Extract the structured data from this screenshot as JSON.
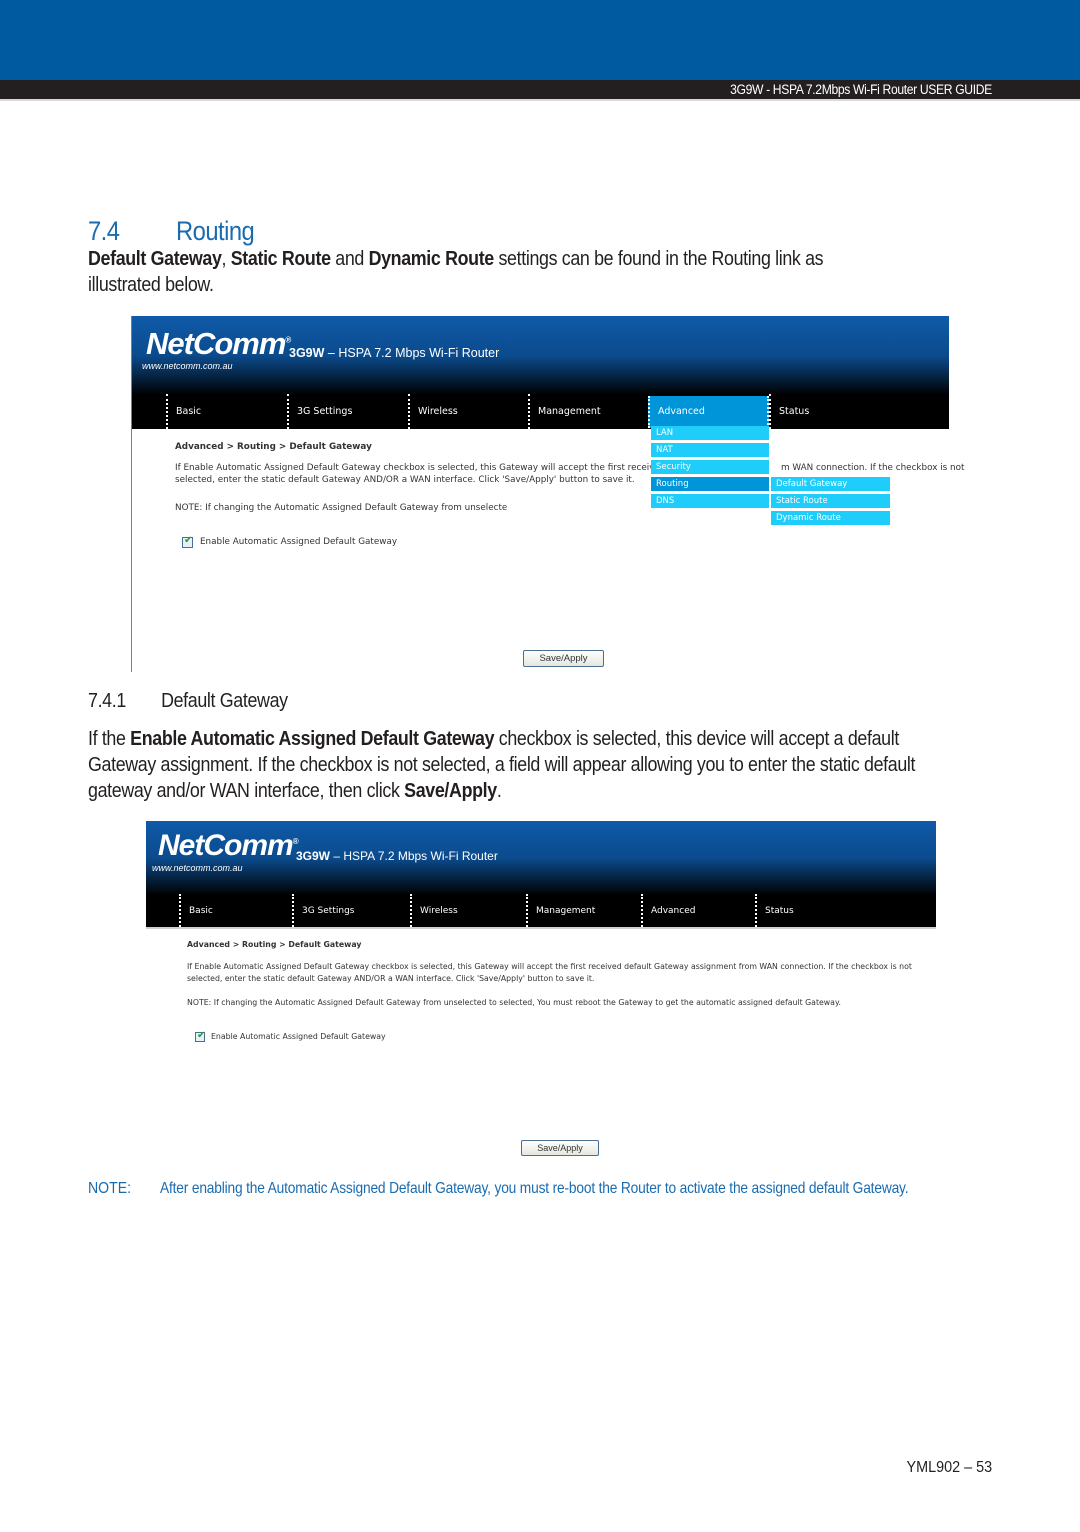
{
  "header": {
    "guide_title": "3G9W - HSPA 7.2Mbps Wi-Fi Router USER GUIDE",
    "colors": {
      "band": "#005aa0",
      "bar": "#231f20",
      "accent_text": "#1a6bb0"
    }
  },
  "section": {
    "number": "7.4",
    "title": "Routing",
    "intro": {
      "b1": "Default Gateway",
      "t1": ", ",
      "b2": "Static Route",
      "t2": " and ",
      "b3": "Dynamic Route",
      "t3": " settings can be found in the Routing link as",
      "line2": "illustrated below."
    }
  },
  "screenshot1": {
    "logo": "NetComm",
    "logo_mark": "®",
    "logo_url": "www.netcomm.com.au",
    "product_bold": "3G9W",
    "product_rest": " – HSPA 7.2 Mbps Wi-Fi Router",
    "nav": [
      "Basic",
      "3G Settings",
      "Wireless",
      "Management",
      "Advanced",
      "Status"
    ],
    "active_nav": "Advanced",
    "dropdown": [
      "LAN",
      "NAT",
      "Security",
      "Routing",
      "DNS"
    ],
    "dropdown_selected": "Routing",
    "submenu": [
      "Default Gateway",
      "Static Route",
      "Dynamic Route"
    ],
    "breadcrumb": "Advanced > Routing > Default Gateway",
    "desc_line1_a": "If Enable Automatic Assigned Default Gateway checkbox is selected, this Gateway will accept the first received def",
    "desc_line1_b": "m WAN connection. If the checkbox is not",
    "desc_line2": "selected, enter the static default Gateway AND/OR a WAN interface. Click 'Save/Apply' button to save it.",
    "note": "NOTE: If changing the Automatic Assigned Default Gateway from unselected to selected, You must reboot the Gateway to get the automatic as",
    "checkbox_label": "Enable Automatic Assigned Default Gateway",
    "checkbox_checked": true,
    "button": "Save/Apply",
    "colors": {
      "dropdown": "#1ecdfa",
      "dropdown_selected": "#0095d9"
    }
  },
  "subsection": {
    "number": "7.4.1",
    "title": "Default Gateway",
    "p_t1": "If the ",
    "p_b1": "Enable Automatic Assigned Default Gateway",
    "p_t2": " checkbox is selected, this device will accept a default",
    "p_line2": "Gateway assignment.  If the checkbox is not selected, a field will appear allowing you to enter the static default",
    "p_t3": "gateway and/or WAN interface, then click ",
    "p_b2": "Save/Apply",
    "p_t4": "."
  },
  "screenshot2": {
    "logo": "NetComm",
    "logo_mark": "®",
    "logo_url": "www.netcomm.com.au",
    "product_bold": "3G9W",
    "product_rest": " – HSPA 7.2 Mbps Wi-Fi Router",
    "nav": [
      "Basic",
      "3G Settings",
      "Wireless",
      "Management",
      "Advanced",
      "Status"
    ],
    "breadcrumb": "Advanced > Routing > Default Gateway",
    "desc_line1": "If Enable Automatic Assigned Default Gateway checkbox is selected, this Gateway will accept the first received default Gateway assignment from WAN connection. If the checkbox is not",
    "desc_line2": "selected, enter the static default Gateway AND/OR a WAN interface. Click 'Save/Apply' button to save it.",
    "note": "NOTE: If changing the Automatic Assigned Default Gateway from unselected to selected, You must reboot the Gateway to get the automatic assigned default Gateway.",
    "checkbox_label": "Enable Automatic Assigned Default Gateway",
    "checkbox_checked": true,
    "button": "Save/Apply"
  },
  "note": {
    "label": "NOTE:",
    "text": "After enabling the Automatic Assigned Default Gateway, you must re-boot the Router to activate the assigned default Gateway."
  },
  "footer": {
    "page": "YML902 – 53"
  }
}
